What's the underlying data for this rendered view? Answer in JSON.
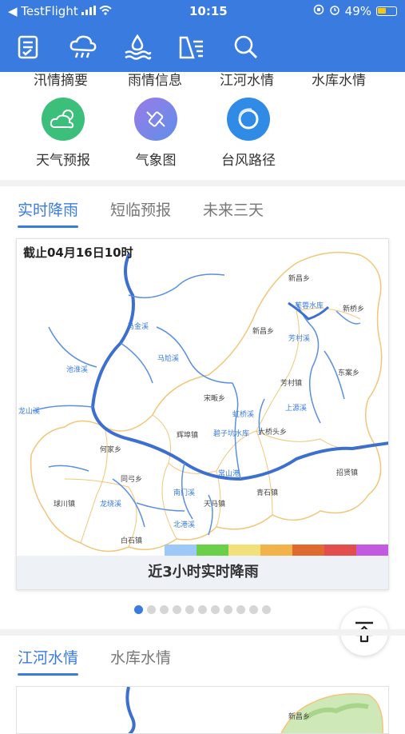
{
  "status_bar": {
    "back_app": "◀ TestFlight",
    "time": "10:15",
    "battery": "49%"
  },
  "toolbar": {
    "icons": [
      "report-icon",
      "rain-cloud-icon",
      "water-level-icon",
      "reservoir-icon",
      "search-icon"
    ]
  },
  "nav_top_row": [
    "汛情摘要",
    "雨情信息",
    "江河水情",
    "水库水情"
  ],
  "nav_items": [
    {
      "label": "天气预报",
      "icon": "weather-icon",
      "color": "#3bbf7a"
    },
    {
      "label": "气象图",
      "icon": "satellite-icon",
      "color": "#7b6fe0"
    },
    {
      "label": "台风路径",
      "icon": "typhoon-icon",
      "color": "#2f8be6"
    }
  ],
  "rain_tabs": [
    {
      "label": "实时降雨",
      "active": true
    },
    {
      "label": "短临预报",
      "active": false
    },
    {
      "label": "未来三天",
      "active": false
    }
  ],
  "map": {
    "timestamp": "截止04月16日10时",
    "caption": "近3小时实时降雨",
    "legend_colors": [
      "#9ec8f8",
      "#6ccf4c",
      "#f2e07a",
      "#f2b34a",
      "#e0692f",
      "#e34d4d",
      "#c35be0"
    ],
    "legend_ticks": [
      "50",
      "100",
      "250"
    ],
    "place_labels": [
      "新昌乡",
      "芙蓉水库",
      "新桥乡",
      "新昌乡",
      "芳村溪",
      "东案乡",
      "芳村镇",
      "宋畈乡",
      "上源溪",
      "辉埠镇",
      "虹桥溪",
      "碧子坑水库",
      "大桥头乡",
      "何家乡",
      "常山港",
      "招贤镇",
      "同弓乡",
      "球川镇",
      "龙绕溪",
      "南门溪",
      "天马镇",
      "青石镇",
      "白石镇",
      "北港溪",
      "马金溪",
      "马尬溪",
      "池淮溪",
      "龙山溪"
    ]
  },
  "pager": {
    "count": 11,
    "active": 0
  },
  "water_tabs": [
    {
      "label": "江河水情",
      "active": true
    },
    {
      "label": "水库水情",
      "active": false
    }
  ],
  "map2_label": "新昌乡"
}
